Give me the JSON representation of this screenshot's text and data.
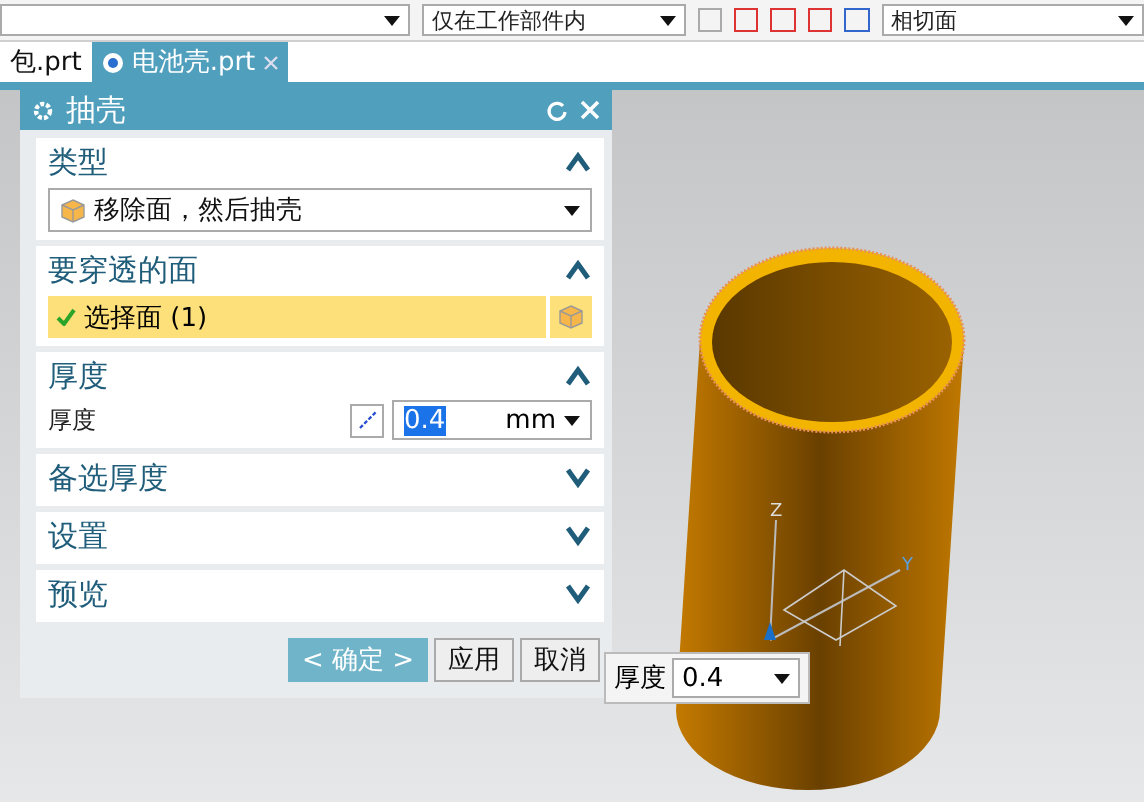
{
  "toolbar": {
    "dropdowns": [
      {
        "value": "仅在工作部件内"
      },
      {
        "value": "相切面"
      }
    ]
  },
  "tabs": [
    {
      "label": "包.prt",
      "selected": false
    },
    {
      "label": "电池壳.prt",
      "selected": true
    }
  ],
  "dialog": {
    "title": "抽壳",
    "sections": [
      {
        "kind": "dropdown",
        "title": "类型",
        "expanded": true,
        "value": "移除面，然后抽壳"
      },
      {
        "kind": "selection",
        "title": "要穿透的面",
        "expanded": true,
        "label": "选择面 (1)",
        "done": true
      },
      {
        "kind": "thickness",
        "title": "厚度",
        "expanded": true,
        "label": "厚度",
        "value": "0.4",
        "unit": "mm"
      },
      {
        "title": "备选厚度",
        "expanded": false
      },
      {
        "title": "设置",
        "expanded": false
      },
      {
        "title": "预览",
        "expanded": false
      }
    ],
    "buttons": [
      {
        "label": "< 确定 >",
        "kind": "primary"
      },
      {
        "label": "应用",
        "kind": "normal"
      },
      {
        "label": "取消",
        "kind": "normal"
      }
    ]
  },
  "triad": {
    "z": "Z",
    "y": "Y"
  },
  "thickness_popup": {
    "label": "厚度",
    "value": "0.4"
  }
}
